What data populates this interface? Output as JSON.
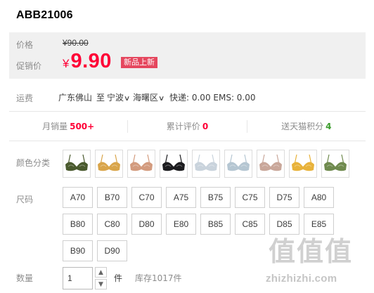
{
  "product": {
    "title": "ABB21006"
  },
  "price": {
    "label": "价格",
    "original": "¥90.00",
    "promo_label": "促销价",
    "promo_currency": "¥",
    "promo_value": "9.90",
    "badge": "新品上新"
  },
  "shipping": {
    "label": "运费",
    "from": "广东佛山",
    "to_word": "至",
    "dest_city": "宁波",
    "dest_district": "海曙区",
    "fees": "快递: 0.00  EMS: 0.00"
  },
  "stats": {
    "monthly_sales_label": "月销量",
    "monthly_sales_value": "500+",
    "monthly_sales_color": "#ff0036",
    "reviews_label": "累计评价",
    "reviews_value": "0",
    "reviews_color": "#ff0036",
    "points_label": "送天猫积分",
    "points_value": "4",
    "points_color": "#3b9c2c"
  },
  "color": {
    "label": "颜色分类",
    "swatches": [
      {
        "icon": "bra-camo-icon",
        "color": "#4a5a2e"
      },
      {
        "icon": "bra-mustard-icon",
        "color": "#d9a54a"
      },
      {
        "icon": "bra-nude-icon",
        "color": "#d39b7e"
      },
      {
        "icon": "bra-black-icon",
        "color": "#1c1c1f"
      },
      {
        "icon": "bra-pale-blue-icon",
        "color": "#c9d3dc"
      },
      {
        "icon": "bra-light-blue-icon",
        "color": "#b5c6d2"
      },
      {
        "icon": "bra-floral-icon",
        "color": "#c9a79a"
      },
      {
        "icon": "bra-yellow-icon",
        "color": "#e8b23a"
      },
      {
        "icon": "bra-green-floral-icon",
        "color": "#6f8a4e"
      }
    ]
  },
  "size": {
    "label": "尺码",
    "options": [
      "A70",
      "B70",
      "C70",
      "A75",
      "B75",
      "C75",
      "D75",
      "A80",
      "B80",
      "C80",
      "D80",
      "E80",
      "B85",
      "C85",
      "D85",
      "E85",
      "B90",
      "D90"
    ]
  },
  "quantity": {
    "label": "数量",
    "value": "1",
    "unit": "件",
    "stock": "库存1017件",
    "up_icon": "chevron-up-icon",
    "down_icon": "chevron-down-icon"
  },
  "watermark": {
    "glyphs": [
      "值",
      "值",
      "值"
    ],
    "text": "zhizhizhi.com"
  }
}
